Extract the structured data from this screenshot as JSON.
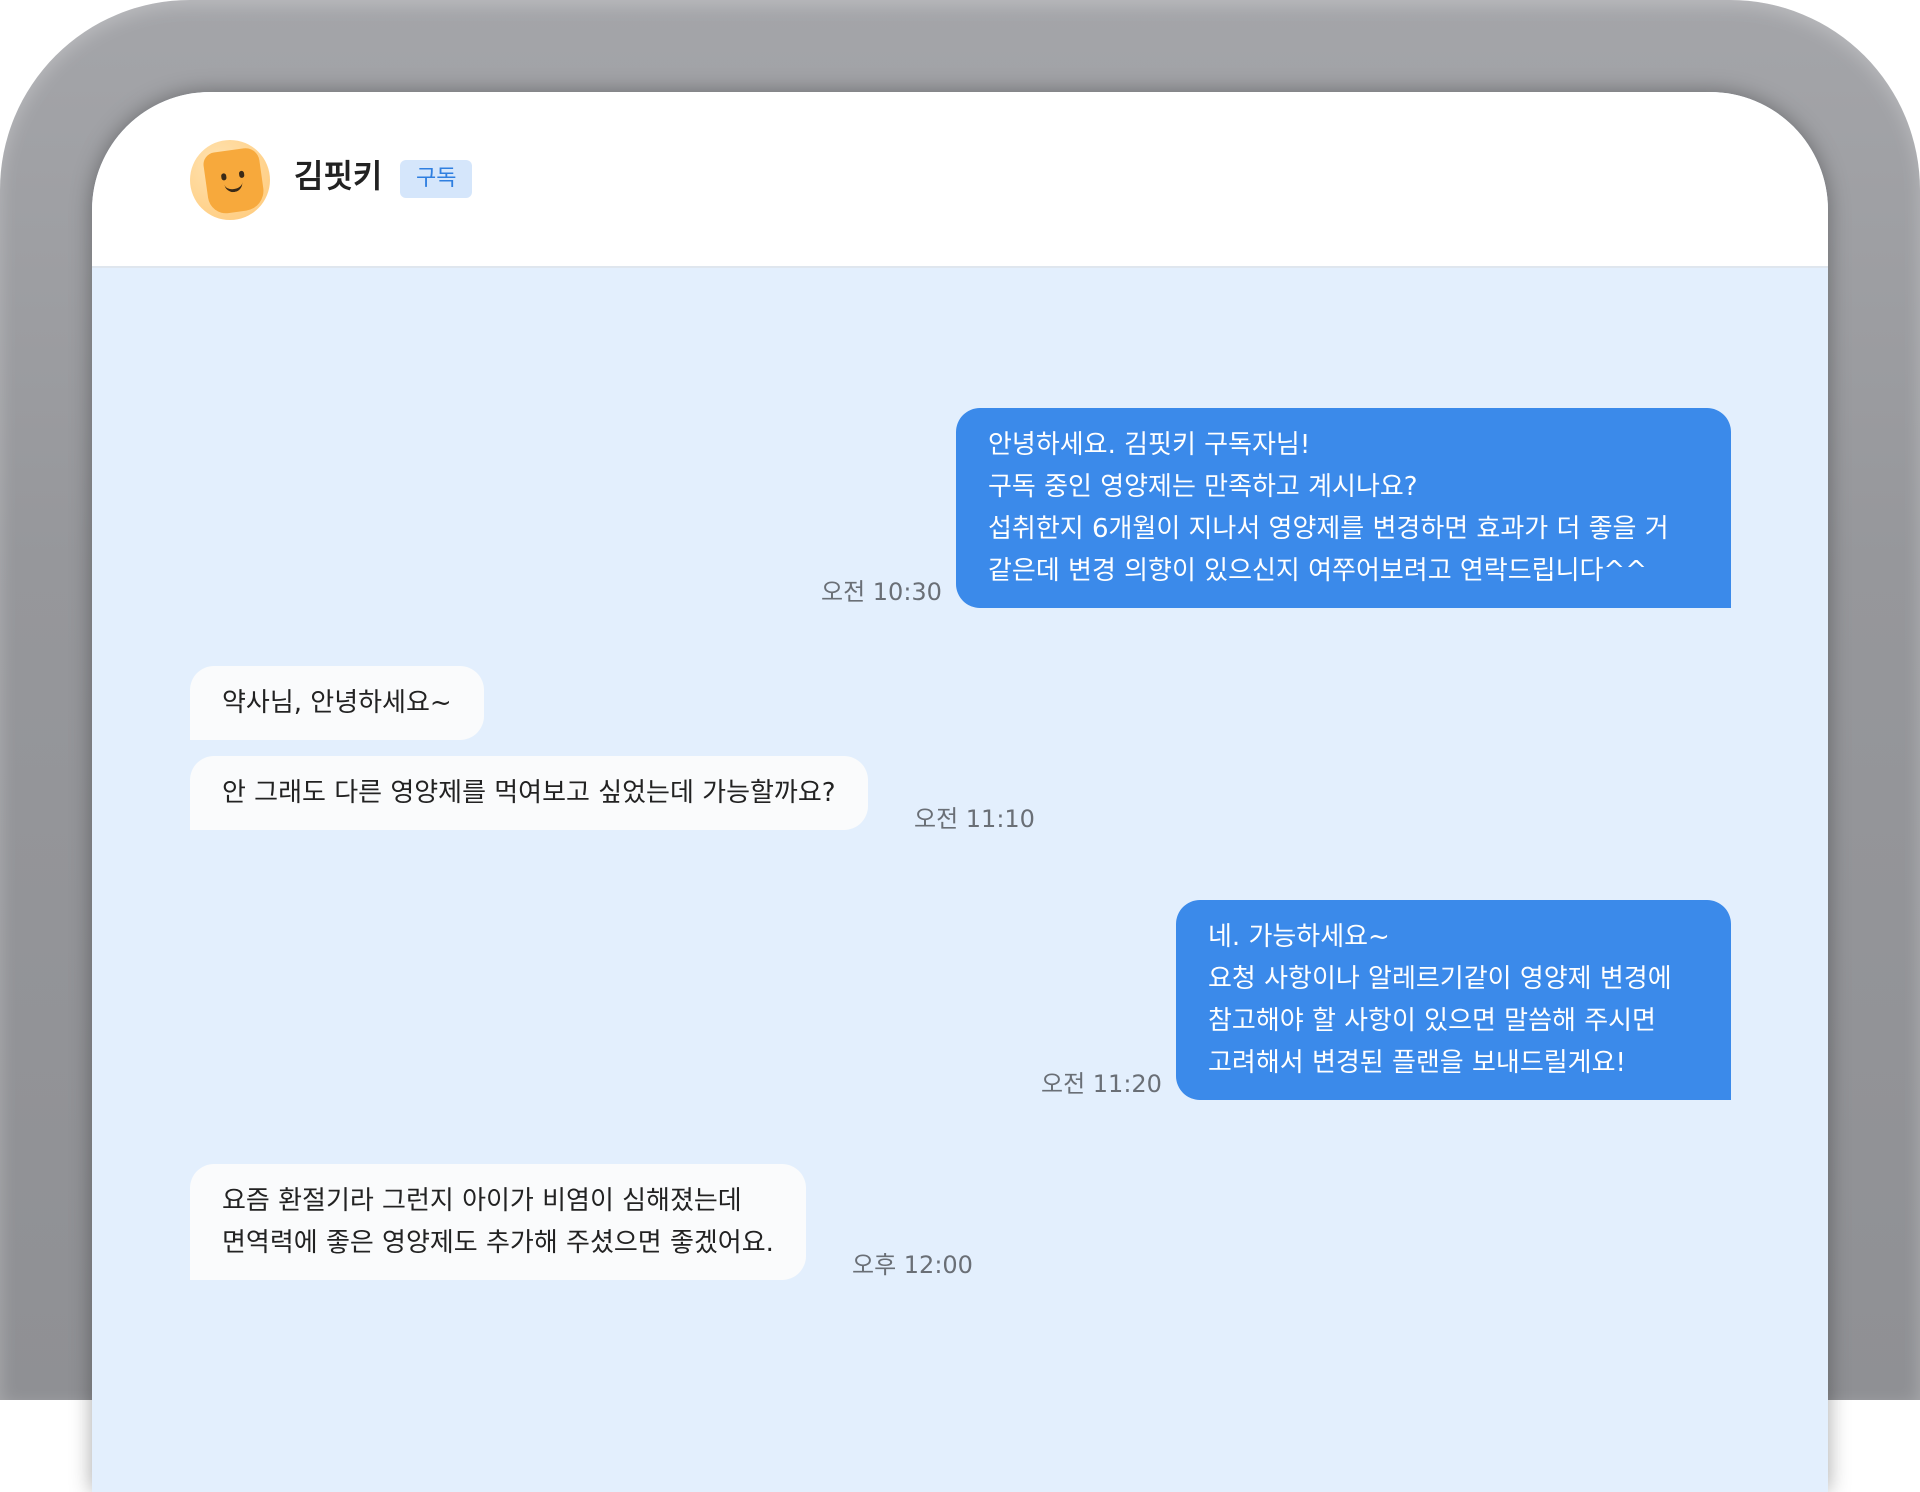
{
  "header": {
    "user_name": "김핏키",
    "badge": "구독",
    "avatar_icon": "smiley-avatar-icon"
  },
  "messages": [
    {
      "sender": "pharmacist",
      "text": "안녕하세요. 김핏키 구독자님!\n구독 중인 영양제는 만족하고 계시나요?\n섭취한지 6개월이 지나서 영양제를 변경하면 효과가 더 좋을 거\n같은데 변경 의향이 있으신지 여쭈어보려고 연락드립니다^^",
      "time": "오전 10:30"
    },
    {
      "sender": "customer",
      "text": "약사님, 안녕하세요~"
    },
    {
      "sender": "customer",
      "text": "안 그래도 다른 영양제를 먹여보고 싶었는데 가능할까요?",
      "time": "오전 11:10"
    },
    {
      "sender": "pharmacist",
      "text": "네. 가능하세요~\n요청 사항이나 알레르기같이 영양제 변경에\n참고해야 할 사항이 있으면 말씀해 주시면\n고려해서 변경된 플랜을 보내드릴게요!",
      "time": "오전 11:20"
    },
    {
      "sender": "customer",
      "text": "요즘 환절기라 그런지 아이가 비염이 심해졌는데\n면역력에 좋은 영양제도 추가해 주셨으면 좋겠어요.",
      "time": "오후 12:00"
    }
  ],
  "colors": {
    "sent_bubble": "#3b8aea",
    "received_bubble": "#fafbfc",
    "chat_background": "#e3effd",
    "badge_background": "#d5e6fb",
    "badge_text": "#2f7fe0"
  }
}
